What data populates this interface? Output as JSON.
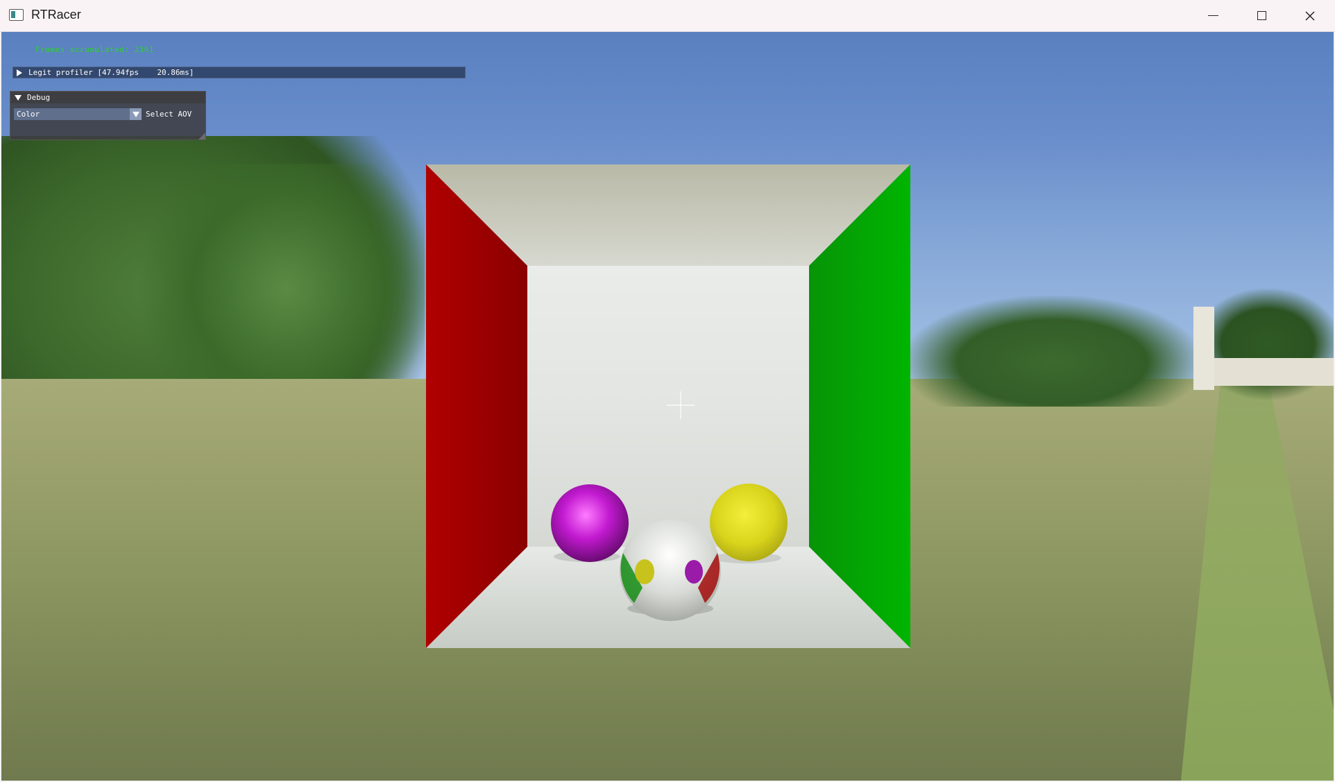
{
  "window": {
    "title": "RTRacer",
    "controls": {
      "minimize": "minimize-icon",
      "maximize": "maximize-icon",
      "close": "close-icon"
    }
  },
  "overlay": {
    "frames_text": "Frames accumulated: 2361"
  },
  "profiler": {
    "label": "Legit profiler [47.94fps    20.86ms]"
  },
  "debug": {
    "title": "Debug",
    "aov_value": "Color",
    "aov_label": "Select AOV"
  },
  "colors": {
    "accent_green": "#2fd02f",
    "panel_bg": "#3e3e42",
    "combo_bg": "#5f6f8c",
    "profiler_bg": "#33486e"
  }
}
